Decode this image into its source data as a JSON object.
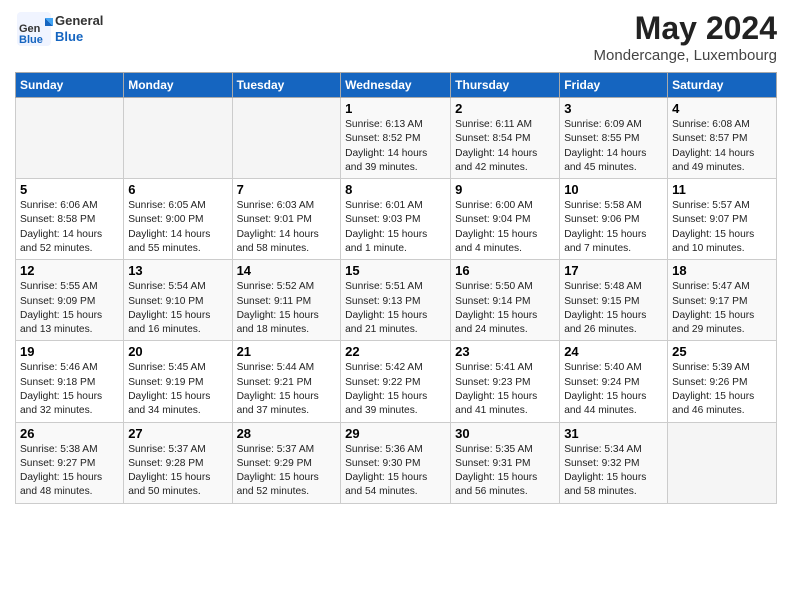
{
  "header": {
    "logo_line1": "General",
    "logo_line2": "Blue",
    "month": "May 2024",
    "location": "Mondercange, Luxembourg"
  },
  "days_of_week": [
    "Sunday",
    "Monday",
    "Tuesday",
    "Wednesday",
    "Thursday",
    "Friday",
    "Saturday"
  ],
  "weeks": [
    [
      {
        "day": "",
        "info": ""
      },
      {
        "day": "",
        "info": ""
      },
      {
        "day": "",
        "info": ""
      },
      {
        "day": "1",
        "info": "Sunrise: 6:13 AM\nSunset: 8:52 PM\nDaylight: 14 hours and 39 minutes."
      },
      {
        "day": "2",
        "info": "Sunrise: 6:11 AM\nSunset: 8:54 PM\nDaylight: 14 hours and 42 minutes."
      },
      {
        "day": "3",
        "info": "Sunrise: 6:09 AM\nSunset: 8:55 PM\nDaylight: 14 hours and 45 minutes."
      },
      {
        "day": "4",
        "info": "Sunrise: 6:08 AM\nSunset: 8:57 PM\nDaylight: 14 hours and 49 minutes."
      }
    ],
    [
      {
        "day": "5",
        "info": "Sunrise: 6:06 AM\nSunset: 8:58 PM\nDaylight: 14 hours and 52 minutes."
      },
      {
        "day": "6",
        "info": "Sunrise: 6:05 AM\nSunset: 9:00 PM\nDaylight: 14 hours and 55 minutes."
      },
      {
        "day": "7",
        "info": "Sunrise: 6:03 AM\nSunset: 9:01 PM\nDaylight: 14 hours and 58 minutes."
      },
      {
        "day": "8",
        "info": "Sunrise: 6:01 AM\nSunset: 9:03 PM\nDaylight: 15 hours and 1 minute."
      },
      {
        "day": "9",
        "info": "Sunrise: 6:00 AM\nSunset: 9:04 PM\nDaylight: 15 hours and 4 minutes."
      },
      {
        "day": "10",
        "info": "Sunrise: 5:58 AM\nSunset: 9:06 PM\nDaylight: 15 hours and 7 minutes."
      },
      {
        "day": "11",
        "info": "Sunrise: 5:57 AM\nSunset: 9:07 PM\nDaylight: 15 hours and 10 minutes."
      }
    ],
    [
      {
        "day": "12",
        "info": "Sunrise: 5:55 AM\nSunset: 9:09 PM\nDaylight: 15 hours and 13 minutes."
      },
      {
        "day": "13",
        "info": "Sunrise: 5:54 AM\nSunset: 9:10 PM\nDaylight: 15 hours and 16 minutes."
      },
      {
        "day": "14",
        "info": "Sunrise: 5:52 AM\nSunset: 9:11 PM\nDaylight: 15 hours and 18 minutes."
      },
      {
        "day": "15",
        "info": "Sunrise: 5:51 AM\nSunset: 9:13 PM\nDaylight: 15 hours and 21 minutes."
      },
      {
        "day": "16",
        "info": "Sunrise: 5:50 AM\nSunset: 9:14 PM\nDaylight: 15 hours and 24 minutes."
      },
      {
        "day": "17",
        "info": "Sunrise: 5:48 AM\nSunset: 9:15 PM\nDaylight: 15 hours and 26 minutes."
      },
      {
        "day": "18",
        "info": "Sunrise: 5:47 AM\nSunset: 9:17 PM\nDaylight: 15 hours and 29 minutes."
      }
    ],
    [
      {
        "day": "19",
        "info": "Sunrise: 5:46 AM\nSunset: 9:18 PM\nDaylight: 15 hours and 32 minutes."
      },
      {
        "day": "20",
        "info": "Sunrise: 5:45 AM\nSunset: 9:19 PM\nDaylight: 15 hours and 34 minutes."
      },
      {
        "day": "21",
        "info": "Sunrise: 5:44 AM\nSunset: 9:21 PM\nDaylight: 15 hours and 37 minutes."
      },
      {
        "day": "22",
        "info": "Sunrise: 5:42 AM\nSunset: 9:22 PM\nDaylight: 15 hours and 39 minutes."
      },
      {
        "day": "23",
        "info": "Sunrise: 5:41 AM\nSunset: 9:23 PM\nDaylight: 15 hours and 41 minutes."
      },
      {
        "day": "24",
        "info": "Sunrise: 5:40 AM\nSunset: 9:24 PM\nDaylight: 15 hours and 44 minutes."
      },
      {
        "day": "25",
        "info": "Sunrise: 5:39 AM\nSunset: 9:26 PM\nDaylight: 15 hours and 46 minutes."
      }
    ],
    [
      {
        "day": "26",
        "info": "Sunrise: 5:38 AM\nSunset: 9:27 PM\nDaylight: 15 hours and 48 minutes."
      },
      {
        "day": "27",
        "info": "Sunrise: 5:37 AM\nSunset: 9:28 PM\nDaylight: 15 hours and 50 minutes."
      },
      {
        "day": "28",
        "info": "Sunrise: 5:37 AM\nSunset: 9:29 PM\nDaylight: 15 hours and 52 minutes."
      },
      {
        "day": "29",
        "info": "Sunrise: 5:36 AM\nSunset: 9:30 PM\nDaylight: 15 hours and 54 minutes."
      },
      {
        "day": "30",
        "info": "Sunrise: 5:35 AM\nSunset: 9:31 PM\nDaylight: 15 hours and 56 minutes."
      },
      {
        "day": "31",
        "info": "Sunrise: 5:34 AM\nSunset: 9:32 PM\nDaylight: 15 hours and 58 minutes."
      },
      {
        "day": "",
        "info": ""
      }
    ]
  ]
}
